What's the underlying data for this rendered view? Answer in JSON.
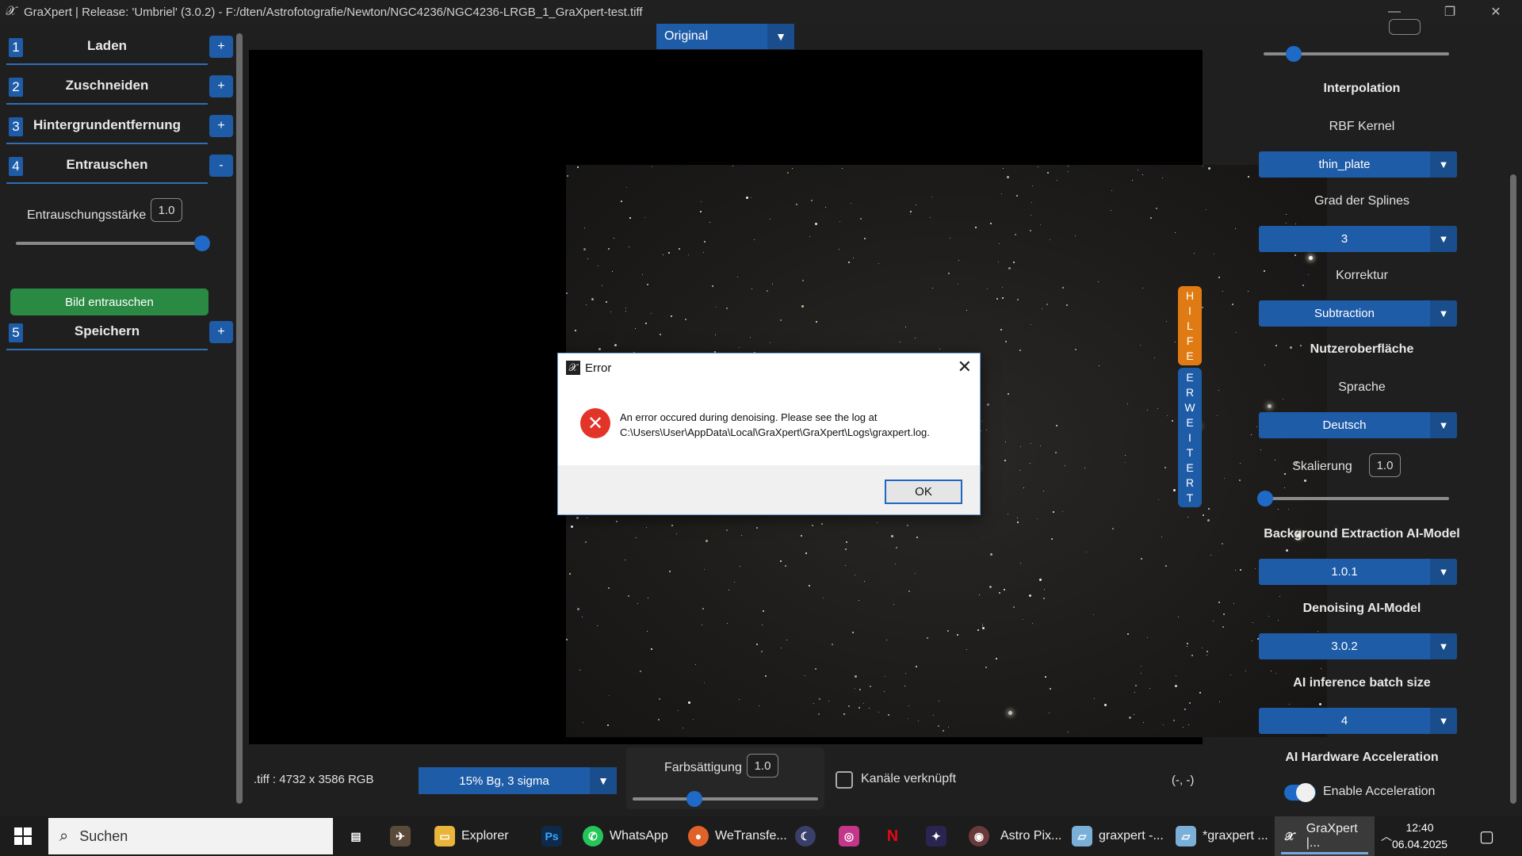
{
  "window": {
    "title": "GraXpert | Release: 'Umbriel' (3.0.2) - F:/dten/Astrofotografie/Newton/NGC4236/NGC4236-LRGB_1_GraXpert-test.tiff",
    "minimize": "—",
    "maximize": "❐",
    "close": "✕"
  },
  "left": {
    "steps": [
      {
        "num": "1",
        "label": "Laden",
        "toggle": "+"
      },
      {
        "num": "2",
        "label": "Zuschneiden",
        "toggle": "+"
      },
      {
        "num": "3",
        "label": "Hintergrundentfernung",
        "toggle": "+"
      },
      {
        "num": "4",
        "label": "Entrauschen",
        "toggle": "-"
      },
      {
        "num": "5",
        "label": "Speichern",
        "toggle": "+"
      }
    ],
    "denoise_strength_label": "Entrauschungsstärke",
    "denoise_strength_value": "1.0",
    "denoise_strength_level": 1.0,
    "denoise_button": "Bild entrauschen"
  },
  "view": {
    "mode": "Original"
  },
  "side_tabs": {
    "help": [
      "H",
      "I",
      "L",
      "F",
      "E"
    ],
    "extended": [
      "E",
      "R",
      "W",
      "E",
      "I",
      "T",
      "E",
      "R",
      "T"
    ]
  },
  "bottom": {
    "file_info": ".tiff : 4732 x 3586 RGB",
    "stretch": "15% Bg, 3 sigma",
    "saturation_label": "Farbsättigung",
    "saturation_value": "1.0",
    "channels_linked_label": "Kanäle verknüpft",
    "channels_linked": false,
    "coords": "(-, -)"
  },
  "right": {
    "interpolation_head": "Interpolation",
    "rbf_label": "RBF Kernel",
    "rbf_value": "thin_plate",
    "spline_label": "Grad der Splines",
    "spline_value": "3",
    "correction_label": "Korrektur",
    "correction_value": "Subtraction",
    "ui_head": "Nutzeroberfläche",
    "language_label": "Sprache",
    "language_value": "Deutsch",
    "scaling_label": "Skalierung",
    "scaling_value": "1.0",
    "bg_model_head": "Background Extraction AI-Model",
    "bg_model_value": "1.0.1",
    "denoise_model_head": "Denoising AI-Model",
    "denoise_model_value": "3.0.2",
    "batch_head": "AI inference batch size",
    "batch_value": "4",
    "hw_head": "AI Hardware Acceleration",
    "hw_label": "Enable Acceleration",
    "hw_enabled": true
  },
  "dialog": {
    "title": "Error",
    "message_line1": "An error occured during denoising. Please see the log at",
    "message_line2": "C:\\Users\\User\\AppData\\Local\\GraXpert\\GraXpert\\Logs\\graxpert.log.",
    "ok": "OK"
  },
  "taskbar": {
    "search_placeholder": "Suchen",
    "items": [
      {
        "label": "Explorer"
      },
      {
        "label": "Ps"
      },
      {
        "label": "WhatsApp"
      },
      {
        "label": "WeTransfe..."
      },
      {
        "label": "Astro Pix..."
      },
      {
        "label": "graxpert -..."
      },
      {
        "label": "*graxpert ..."
      },
      {
        "label": "GraXpert |..."
      }
    ],
    "time": "12:40",
    "date": "06.04.2025"
  },
  "colors": {
    "accent_blue": "#1f5ca8",
    "green_button": "#2a8a43",
    "help_orange": "#e07b14"
  }
}
